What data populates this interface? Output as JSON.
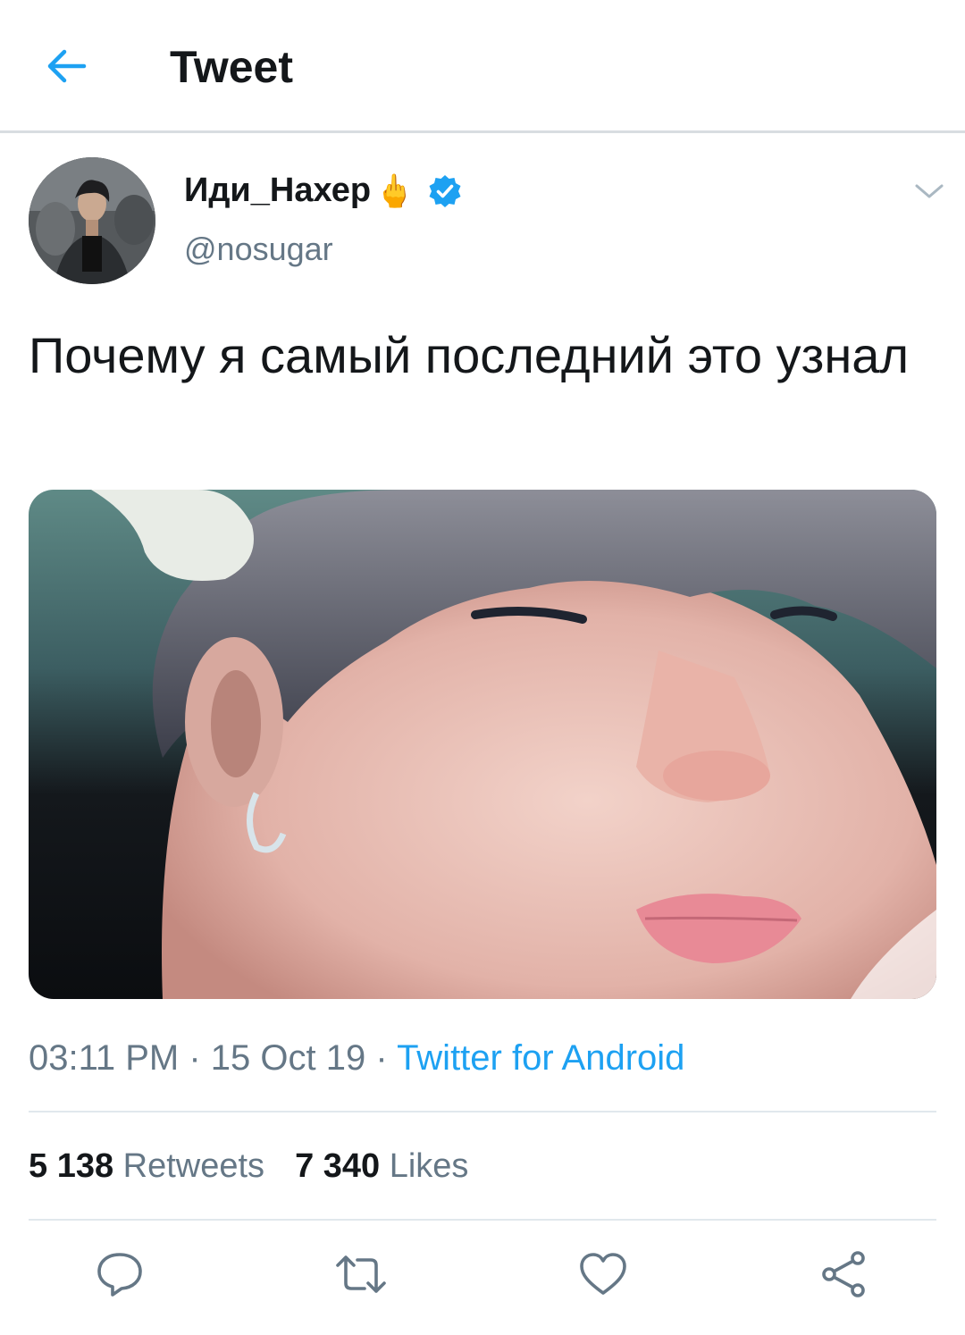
{
  "header": {
    "title": "Tweet",
    "back_icon": "arrow-left-icon",
    "accent": "#1da1f2"
  },
  "tweet": {
    "display_name": "Иди_Нахер",
    "name_emoji": "🖕",
    "verified": true,
    "handle": "@nosugar",
    "text": "Почему я самый последний это узнал",
    "time": "03:11 PM",
    "separator": " · ",
    "date": "15 Oct 19",
    "source": "Twitter for Android"
  },
  "stats": {
    "retweets_count": "5 138",
    "retweets_label": "Retweets",
    "likes_count": "7 340",
    "likes_label": "Likes"
  },
  "actions": [
    "reply-icon",
    "retweet-icon",
    "like-icon",
    "share-icon"
  ],
  "colors": {
    "text": "#14171a",
    "secondary": "#657786",
    "link": "#1da1f2",
    "divider": "#e1e8ed"
  }
}
